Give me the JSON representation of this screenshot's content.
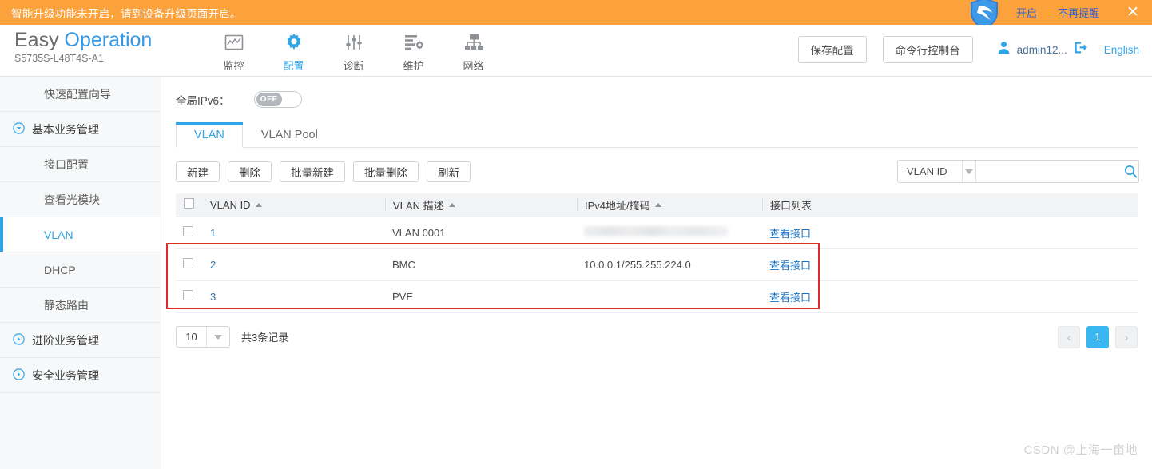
{
  "notice": {
    "message": "智能升级功能未开启，请到设备升级页面开启。",
    "enable_link": "开启",
    "dismiss_link": "不再提醒",
    "close_glyph": "✕",
    "background_color": "#fba23c"
  },
  "header": {
    "brand_primary": "Easy ",
    "brand_accent": "Operation",
    "model": "S5735S-L48T4S-A1",
    "nav": [
      {
        "label": "监控",
        "icon": "monitor-icon",
        "active": false
      },
      {
        "label": "配置",
        "icon": "gear-icon",
        "active": true
      },
      {
        "label": "诊断",
        "icon": "sliders-icon",
        "active": false
      },
      {
        "label": "维护",
        "icon": "maintenance-icon",
        "active": false
      },
      {
        "label": "网络",
        "icon": "network-icon",
        "active": false
      }
    ],
    "save_config_button": "保存配置",
    "cli_console_button": "命令行控制台",
    "user_name": "admin12...",
    "logout_icon": "logout-icon",
    "language": "English",
    "accent_color": "#2fa4e7"
  },
  "sidebar": {
    "items": [
      {
        "label": "快速配置向导",
        "type": "item",
        "active": false
      },
      {
        "label": "基本业务管理",
        "type": "group",
        "expanded": true,
        "active": false
      },
      {
        "label": "接口配置",
        "type": "sub",
        "active": false
      },
      {
        "label": "查看光模块",
        "type": "sub",
        "active": false
      },
      {
        "label": "VLAN",
        "type": "sub",
        "active": true
      },
      {
        "label": "DHCP",
        "type": "sub",
        "active": false
      },
      {
        "label": "静态路由",
        "type": "sub",
        "active": false
      },
      {
        "label": "进阶业务管理",
        "type": "group",
        "expanded": false,
        "active": false
      },
      {
        "label": "安全业务管理",
        "type": "group",
        "expanded": false,
        "active": false
      }
    ]
  },
  "main": {
    "ipv6_label": "全局IPv6：",
    "ipv6_toggle_state": "OFF",
    "tabs": [
      {
        "label": "VLAN",
        "active": true
      },
      {
        "label": "VLAN Pool",
        "active": false
      }
    ],
    "toolbar_buttons": [
      "新建",
      "删除",
      "批量新建",
      "批量删除",
      "刷新"
    ],
    "search": {
      "select_value": "VLAN ID",
      "input_value": "",
      "input_placeholder": "",
      "search_icon": "search-icon"
    },
    "table": {
      "columns": [
        "VLAN ID",
        "VLAN 描述",
        "IPv4地址/掩码",
        "接口列表"
      ],
      "rows": [
        {
          "vlan_id": "1",
          "description": "VLAN 0001",
          "ipv4": "",
          "ipv4_redacted": true,
          "ports_link": "查看接口",
          "highlighted": false
        },
        {
          "vlan_id": "2",
          "description": "BMC",
          "ipv4": "10.0.0.1/255.255.224.0",
          "ipv4_redacted": false,
          "ports_link": "查看接口",
          "highlighted": true
        },
        {
          "vlan_id": "3",
          "description": "PVE",
          "ipv4": "",
          "ipv4_redacted": false,
          "ports_link": "查看接口",
          "highlighted": true
        }
      ]
    },
    "pagination": {
      "page_size": "10",
      "total_text": "共3条记录",
      "prev_glyph": "‹",
      "current_page": "1",
      "next_glyph": "›"
    }
  },
  "watermark": "CSDN @上海一亩地"
}
